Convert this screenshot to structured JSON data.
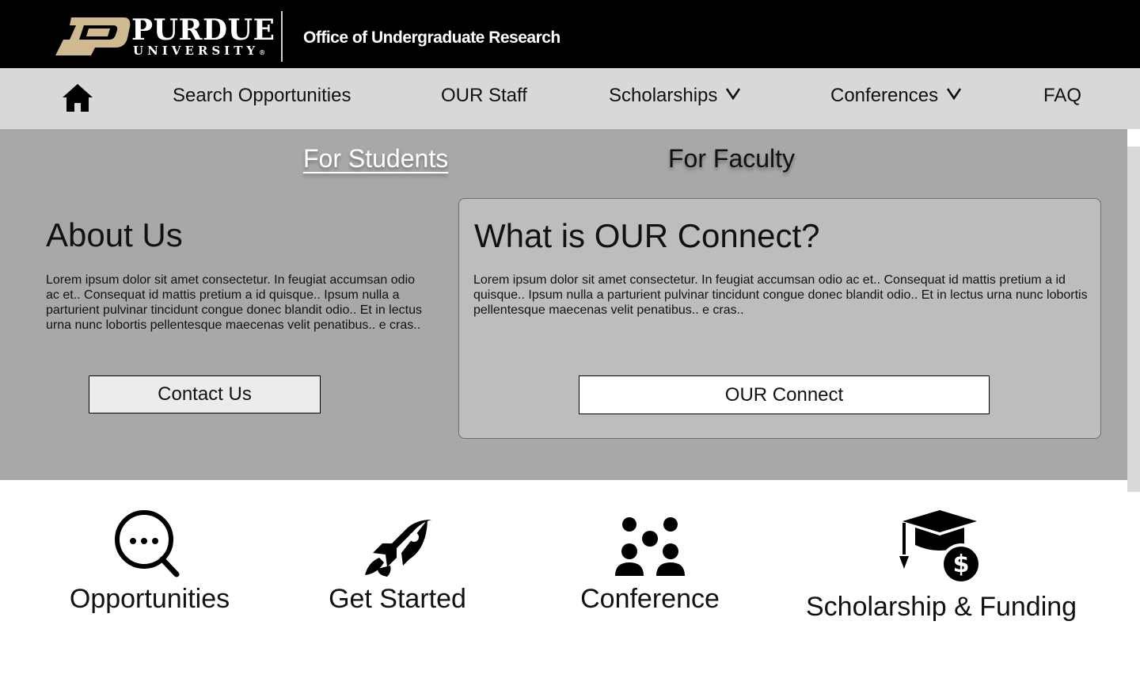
{
  "header": {
    "brand_name": "PURDUE",
    "brand_sub": "UNIVERSITY",
    "brand_mark": "®",
    "office_title": "Office of Undergraduate Research"
  },
  "nav": {
    "home_icon": "home-icon",
    "items": [
      {
        "label": "Search Opportunities"
      },
      {
        "label": "OUR Staff"
      },
      {
        "label": "Scholarships",
        "dropdown": true
      },
      {
        "label": "Conferences",
        "dropdown": true
      },
      {
        "label": "FAQ"
      }
    ]
  },
  "tabs": {
    "students": "For Students",
    "faculty": "For Faculty",
    "active": "students"
  },
  "about": {
    "title": "About Us",
    "body": "Lorem ipsum dolor sit amet consectetur. In feugiat accumsan odio ac et.. Consequat id mattis pretium a id quisque.. Ipsum nulla a parturient pulvinar tincidunt congue donec blandit odio.. Et in lectus urna nunc lobortis pellentesque maecenas velit penatibus.. e cras..",
    "button": "Contact Us"
  },
  "connect": {
    "title": "What is OUR Connect?",
    "body": "Lorem ipsum dolor sit amet consectetur. In feugiat accumsan odio ac et.. Consequat id mattis pretium a id quisque.. Ipsum nulla a parturient pulvinar tincidunt congue donec blandit odio.. Et in lectus urna nunc lobortis pellentesque maecenas velit penatibus.. e cras..",
    "button": "OUR Connect"
  },
  "features": [
    {
      "label": "Opportunities",
      "icon": "search-dots-icon"
    },
    {
      "label": "Get Started",
      "icon": "rocket-icon"
    },
    {
      "label": "Conference",
      "icon": "people-group-icon"
    },
    {
      "label": "Scholarship & Funding",
      "icon": "graduation-cap-dollar-icon"
    }
  ],
  "colors": {
    "header_bg": "#000000",
    "nav_bg": "#d8d8d8",
    "hero_bg": "#a8a8a8",
    "card_bg": "#bdbdbd",
    "logo_gold": "#cfb991"
  }
}
